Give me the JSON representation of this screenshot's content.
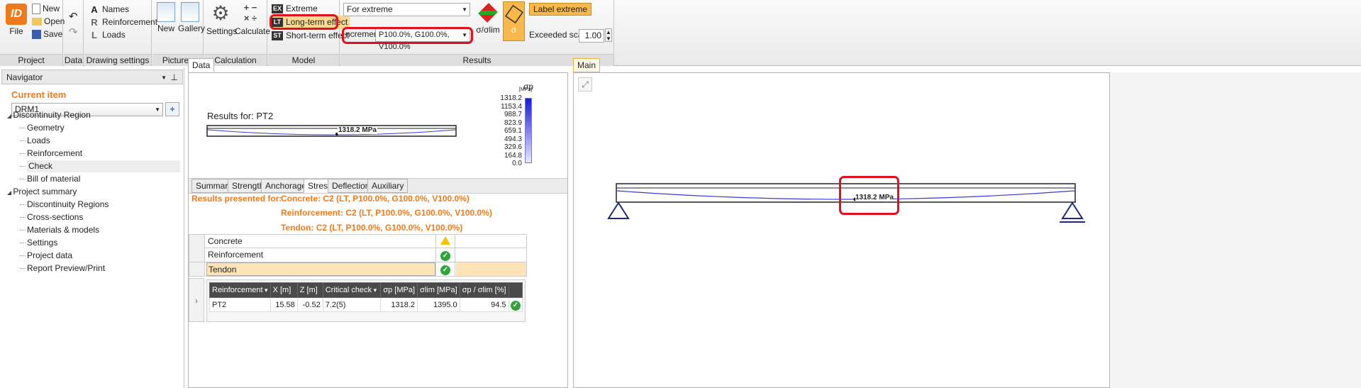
{
  "ribbon": {
    "project": {
      "label": "Project",
      "file": "File",
      "new": "New",
      "open": "Open",
      "save": "Save"
    },
    "data": {
      "label": "Data"
    },
    "drawing": {
      "label": "Drawing settings",
      "names": "Names",
      "reinforcement": "Reinforcement",
      "loads": "Loads"
    },
    "pictures": {
      "label": "Pictures",
      "new": "New",
      "gallery": "Gallery"
    },
    "calculation": {
      "label": "Calculation",
      "settings": "Settings",
      "calculate": "Calculate"
    },
    "model": {
      "label": "Model",
      "extreme": "Extreme",
      "long_term": "Long-term effect",
      "short_term": "Short-term effect",
      "ex_tag": "EX",
      "lt_tag": "LT",
      "st_tag": "ST"
    },
    "results": {
      "label": "Results",
      "combo_extreme": "For extreme",
      "increment_label": "ncrement",
      "increment_value": "P100.0%, G100.0%, V100.0%",
      "sigma_lim": "σ/σlim",
      "sigma": "σ",
      "label_extreme": "Label extreme",
      "exceeded_scale_label": "Exceeded scale",
      "exceeded_scale_value": "1.00"
    }
  },
  "navigator": {
    "title": "Navigator",
    "current_item_label": "Current item",
    "current_item_value": "DRM1",
    "tree": [
      {
        "label": "Discontinuity Region",
        "level": 0
      },
      {
        "label": "Geometry",
        "level": 1
      },
      {
        "label": "Loads",
        "level": 1
      },
      {
        "label": "Reinforcement",
        "level": 1
      },
      {
        "label": "Check",
        "level": 1,
        "selected": true
      },
      {
        "label": "Bill of material",
        "level": 1
      },
      {
        "label": "Project summary",
        "level": 0
      },
      {
        "label": "Discontinuity Regions",
        "level": 1
      },
      {
        "label": "Cross-sections",
        "level": 1
      },
      {
        "label": "Materials & models",
        "level": 1
      },
      {
        "label": "Settings",
        "level": 1
      },
      {
        "label": "Project data",
        "level": 1
      },
      {
        "label": "Report Preview/Print",
        "level": 1
      }
    ]
  },
  "data_panel": {
    "tab": "Data",
    "results_for": "Results for: PT2",
    "value_label": "1318.2 MPa",
    "legend": {
      "symbol": "σp",
      "unit": "[MPa]",
      "values": [
        "1318.2",
        "1153.4",
        "988.7",
        "823.9",
        "659.1",
        "494.3",
        "329.6",
        "164.8",
        "0.0"
      ]
    },
    "tabs": [
      "Summary",
      "Strength",
      "Anchorage",
      "Stress",
      "Deflection",
      "Auxiliary"
    ],
    "active_tab": "Stress",
    "presented_for_label": "Results presented for:",
    "presented_concrete": "Concrete: C2 (LT, P100.0%, G100.0%, V100.0%)",
    "presented_reinforcement": "Reinforcement: C2 (LT, P100.0%, G100.0%, V100.0%)",
    "presented_tendon": "Tendon: C2 (LT, P100.0%, G100.0%, V100.0%)",
    "checks": [
      {
        "name": "Concrete",
        "status": "warning"
      },
      {
        "name": "Reinforcement",
        "status": "ok"
      },
      {
        "name": "Tendon",
        "status": "ok"
      }
    ],
    "table": {
      "headers": [
        "Reinforcement",
        "X [m]",
        "Z [m]",
        "Critical check",
        "σp [MPa]",
        "σlim [MPa]",
        "σp / σlim [%]"
      ],
      "rows": [
        [
          "PT2",
          "15.58",
          "-0.52",
          "7.2(5)",
          "1318.2",
          "1395.0",
          "94.5"
        ]
      ]
    }
  },
  "main_panel": {
    "tab": "Main",
    "value_label": "1318.2 MPa"
  },
  "colors": {
    "accent_orange": "#f07a1a",
    "highlight": "#e0101e",
    "tendon_blue": "#3a3ad8"
  }
}
